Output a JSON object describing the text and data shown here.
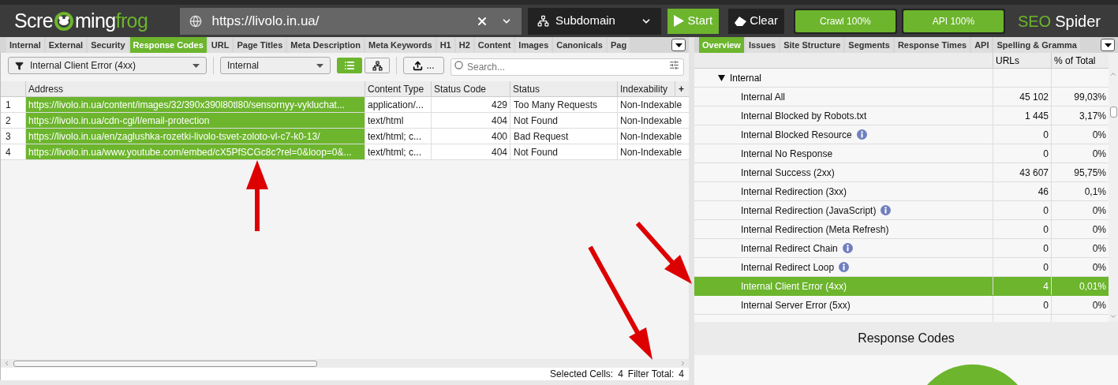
{
  "app": {
    "logo": [
      "Scre",
      "ming",
      "frog"
    ],
    "product": [
      "SEO",
      "Spider"
    ]
  },
  "url_field": {
    "value": "https://livolo.in.ua/"
  },
  "mode_dropdown": {
    "value": "Subdomain"
  },
  "buttons": [
    {
      "kind": "start",
      "label": "Start"
    },
    {
      "kind": "clear",
      "label": "Clear"
    }
  ],
  "progress": [
    {
      "label": "Crawl 100%",
      "level": 1
    },
    {
      "label": "API 100%",
      "level": 1
    }
  ],
  "left_tabs": [
    {
      "label": "Internal",
      "selected": false
    },
    {
      "label": "External",
      "selected": false
    },
    {
      "label": "Security",
      "selected": false
    },
    {
      "label": "Response Codes",
      "selected": true
    },
    {
      "label": "URL",
      "selected": false
    },
    {
      "label": "Page Titles",
      "selected": false
    },
    {
      "label": "Meta Description",
      "selected": false
    },
    {
      "label": "Meta Keywords",
      "selected": false
    },
    {
      "label": "H1",
      "selected": false
    },
    {
      "label": "H2",
      "selected": false
    },
    {
      "label": "Content",
      "selected": false
    },
    {
      "label": "Images",
      "selected": false
    },
    {
      "label": "Canonicals",
      "selected": false
    },
    {
      "label": "Pag",
      "selected": false
    }
  ],
  "toolbar": {
    "filter": "Internal Client Error (4xx)",
    "scope": "Internal",
    "views": [
      {
        "kind": "list",
        "selected": true
      },
      {
        "kind": "tree",
        "selected": false
      }
    ],
    "export": "...",
    "search": {
      "placeholder": "Search..."
    }
  },
  "table": {
    "columns": [
      "Address",
      "Content Type",
      "Status Code",
      "Status",
      "Indexability"
    ],
    "add_column": "+",
    "rows": [
      {
        "index": "1",
        "address": "https://livolo.in.ua/content/images/32/390x390l80tl80/sensornyy-vykluchat...",
        "content_type": "application/...",
        "status_code": "429",
        "status": "Too Many Requests",
        "indexability": "Non-Indexable",
        "selected": true
      },
      {
        "index": "2",
        "address": "https://livolo.in.ua/cdn-cgi/l/email-protection",
        "content_type": "text/html",
        "status_code": "404",
        "status": "Not Found",
        "indexability": "Non-Indexable",
        "selected": true
      },
      {
        "index": "3",
        "address": "https://livolo.in.ua/en/zaglushka-rozetki-livolo-tsvet-zoloto-vl-c7-k0-13/",
        "content_type": "text/html; c...",
        "status_code": "400",
        "status": "Bad Request",
        "indexability": "Non-Indexable",
        "selected": true
      },
      {
        "index": "4",
        "address": "https://livolo.in.ua/www.youtube.com/embed/cX5PfSCGc8c?rel=0&loop=0&...",
        "content_type": "text/html; c...",
        "status_code": "404",
        "status": "Not Found",
        "indexability": "Non-Indexable",
        "selected": true
      }
    ]
  },
  "status_bar": [
    {
      "label": "Selected Cells:",
      "value": "4"
    },
    {
      "label": "Filter Total:",
      "value": "4"
    }
  ],
  "right_tabs": [
    {
      "label": "Overview",
      "selected": true
    },
    {
      "label": "Issues",
      "selected": false
    },
    {
      "label": "Site Structure",
      "selected": false
    },
    {
      "label": "Segments",
      "selected": false
    },
    {
      "label": "Response Times",
      "selected": false
    },
    {
      "label": "API",
      "selected": false
    },
    {
      "label": "Spelling & Gramma",
      "selected": false
    }
  ],
  "overview": {
    "columns": [
      "URLs",
      "% of Total"
    ],
    "tree": [
      {
        "label": "Internal",
        "expanded": true,
        "children": [
          {
            "label": "Internal All",
            "urls": "45 102",
            "percent": "99,03%",
            "info": false,
            "selected": false
          },
          {
            "label": "Internal Blocked by Robots.txt",
            "urls": "1 445",
            "percent": "3,17%",
            "info": false,
            "selected": false
          },
          {
            "label": "Internal Blocked Resource",
            "urls": "0",
            "percent": "0%",
            "info": true,
            "selected": false
          },
          {
            "label": "Internal No Response",
            "urls": "0",
            "percent": "0%",
            "info": false,
            "selected": false
          },
          {
            "label": "Internal Success (2xx)",
            "urls": "43 607",
            "percent": "95,75%",
            "info": false,
            "selected": false
          },
          {
            "label": "Internal Redirection (3xx)",
            "urls": "46",
            "percent": "0,1%",
            "info": false,
            "selected": false
          },
          {
            "label": "Internal Redirection (JavaScript)",
            "urls": "0",
            "percent": "0%",
            "info": true,
            "selected": false
          },
          {
            "label": "Internal Redirection (Meta Refresh)",
            "urls": "0",
            "percent": "0%",
            "info": false,
            "selected": false
          },
          {
            "label": "Internal Redirect Chain",
            "urls": "0",
            "percent": "0%",
            "info": true,
            "selected": false
          },
          {
            "label": "Internal Redirect Loop",
            "urls": "0",
            "percent": "0%",
            "info": true,
            "selected": false
          },
          {
            "label": "Internal Client Error (4xx)",
            "urls": "4",
            "percent": "0,01%",
            "info": false,
            "selected": true
          },
          {
            "label": "Internal Server Error (5xx)",
            "urls": "0",
            "percent": "0%",
            "info": false,
            "selected": false
          }
        ]
      }
    ]
  },
  "chart_panel": {
    "title": "Response Codes"
  }
}
